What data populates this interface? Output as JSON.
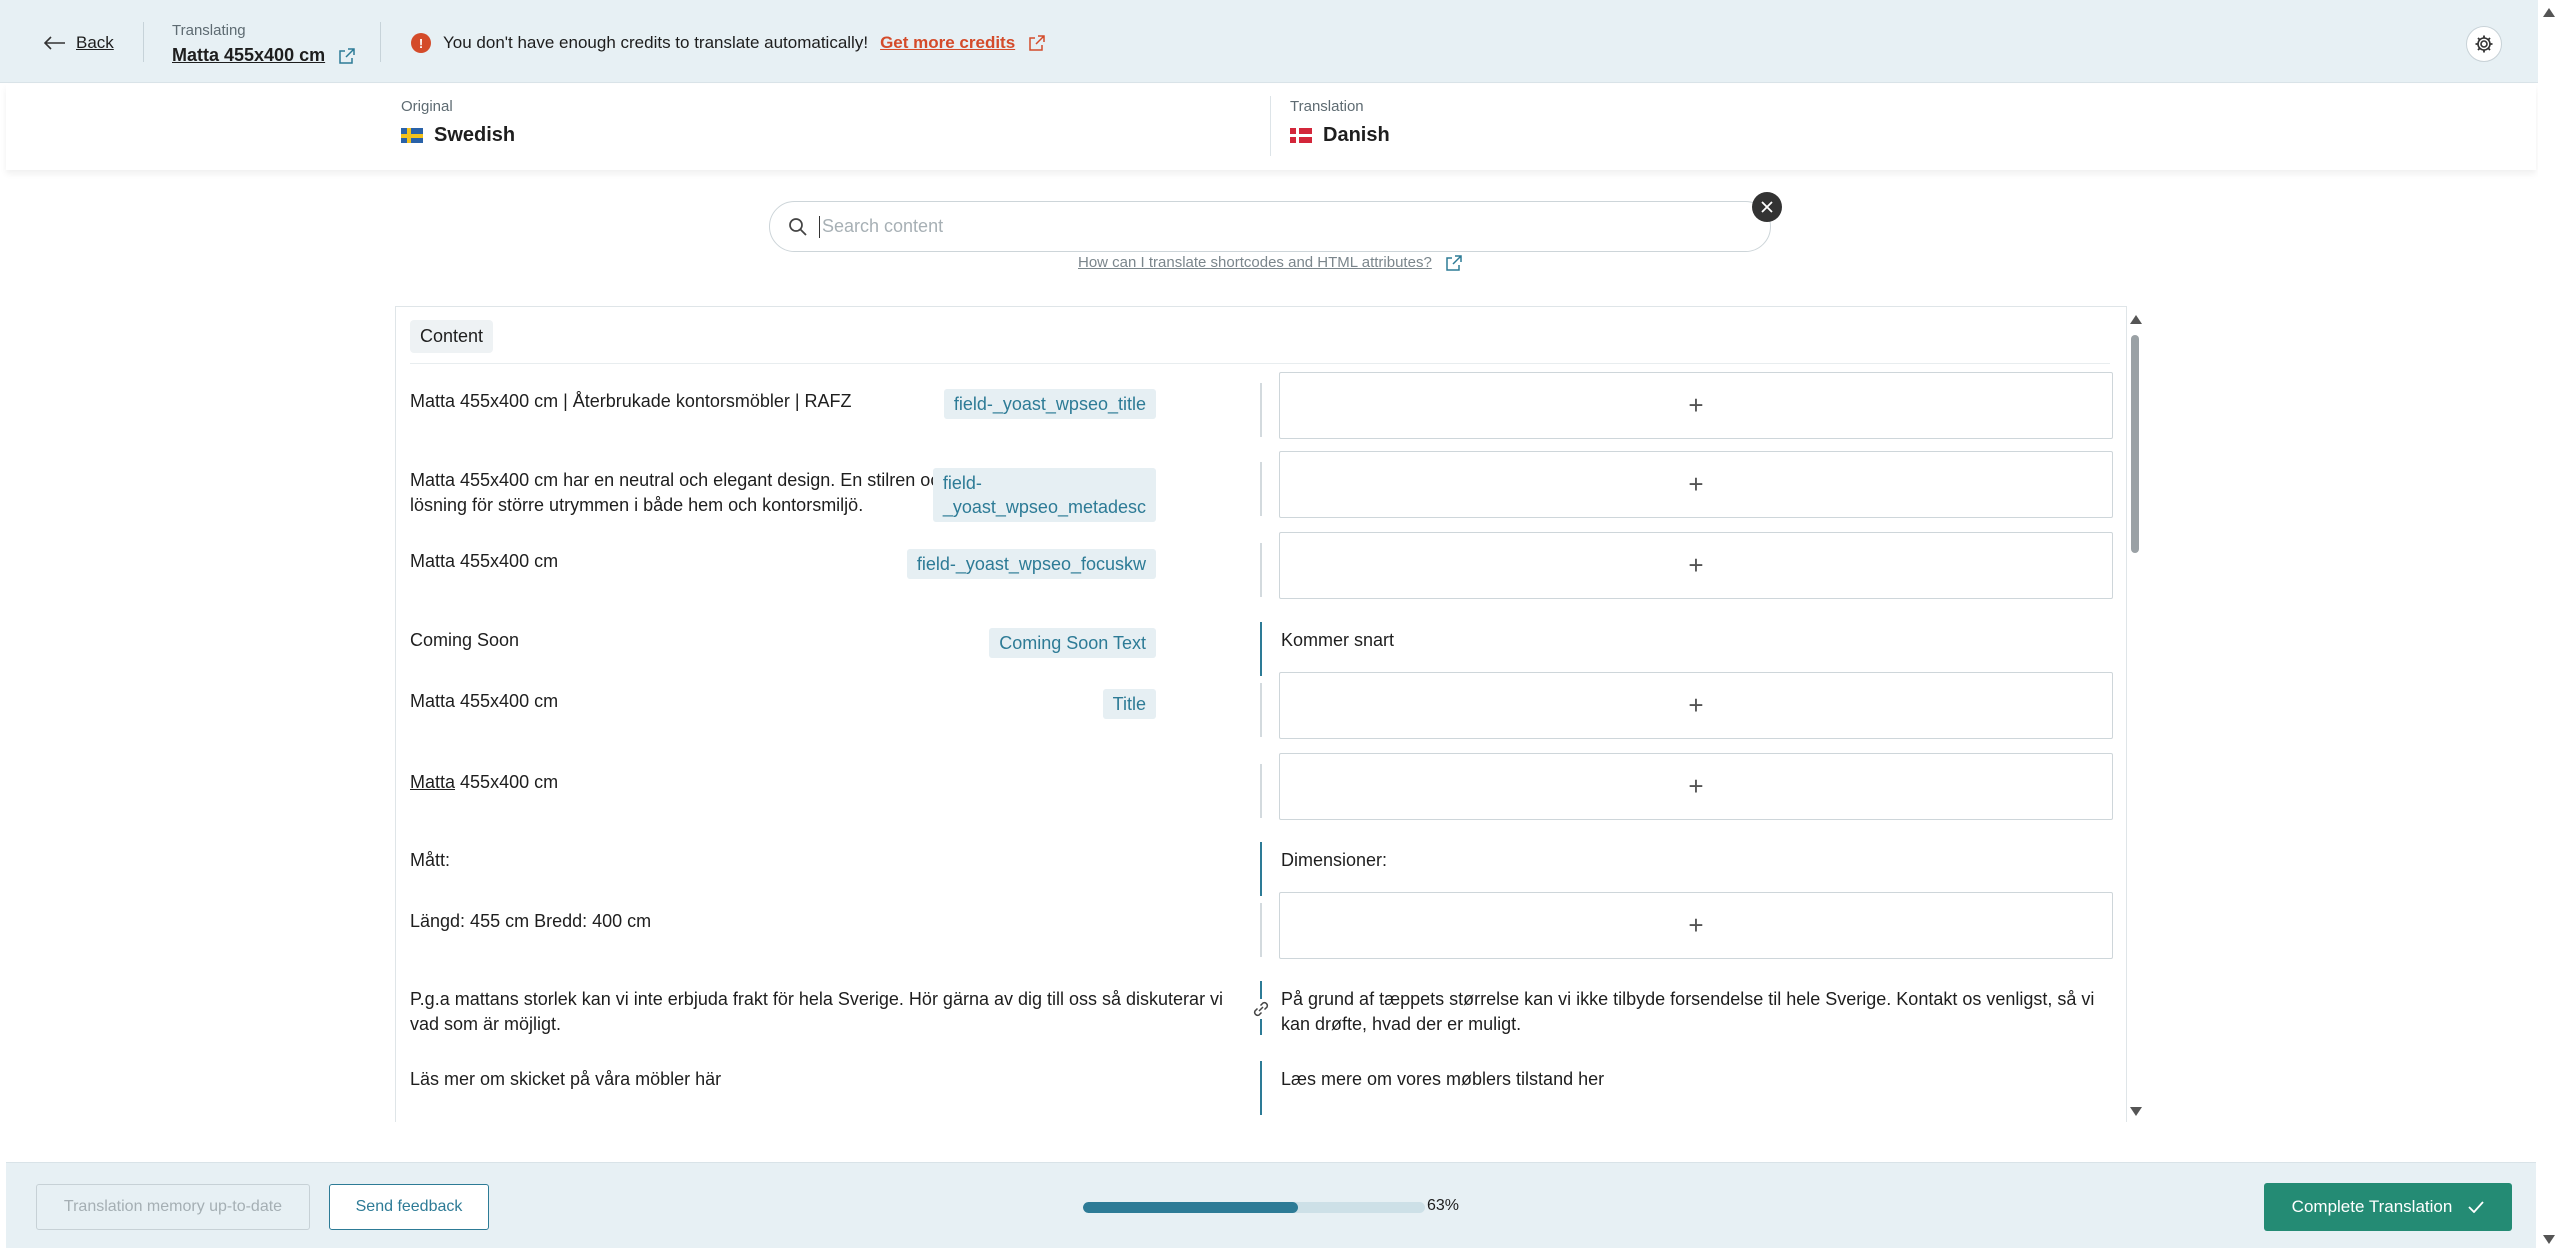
{
  "topbar": {
    "back_label": "Back",
    "translating_label": "Translating",
    "document_title": "Matta 455x400 cm",
    "warning_text": "You don't have enough credits to translate automatically!",
    "credits_link": "Get more credits"
  },
  "languages": {
    "original_label": "Original",
    "original_value": "Swedish",
    "translation_label": "Translation",
    "translation_value": "Danish"
  },
  "search": {
    "placeholder": "Search content",
    "value": "",
    "help_link": "How can I translate shortcodes and HTML attributes?"
  },
  "section_tag": "Content",
  "rows": [
    {
      "source": "Matta 455x400 cm | Återbrukade kontorsmöbler | RAFZ",
      "field": "field-_yoast_wpseo_title",
      "translation": ""
    },
    {
      "source": "Matta 455x400 cm har en neutral och elegant design. En stilren och praktisk lösning för större utrymmen i både hem och kontorsmiljö.",
      "field": "field-\n_yoast_wpseo_metadesc",
      "translation": ""
    },
    {
      "source": "Matta 455x400 cm",
      "field": "field-_yoast_wpseo_focuskw",
      "translation": ""
    },
    {
      "source": "Coming Soon",
      "field": "Coming Soon Text",
      "translation": "Kommer snart"
    },
    {
      "source": "Matta 455x400 cm",
      "field": "Title",
      "translation": ""
    },
    {
      "source_underlined": "Matta",
      "source_rest": " 455x400 cm",
      "translation": ""
    },
    {
      "source": "Mått:",
      "translation": "Dimensioner:"
    },
    {
      "source": "Längd: 455 cm Bredd: 400 cm",
      "translation": ""
    },
    {
      "source": "P.g.a mattans storlek kan vi inte erbjuda frakt för hela Sverige. Hör gärna av dig till oss så diskuterar vi vad som är möjligt.",
      "translation": "På grund af tæppets størrelse kan vi ikke tilbyde forsendelse til hele Sverige. Kontakt os venligst, så vi kan drøfte, hvad der er muligt."
    },
    {
      "source": "Läs mer om skicket på våra möbler här",
      "translation": "Læs mere om vores møblers tilstand her"
    }
  ],
  "footer": {
    "tm_label": "Translation memory up-to-date",
    "feedback_label": "Send feedback",
    "progress": 0.63,
    "progress_text": "63%",
    "complete_label": "Complete Translation"
  },
  "colors": {
    "accent": "#2d7b96",
    "warning": "#d44b2a",
    "complete": "#248b74",
    "topbar_bg": "#e7f0f4"
  },
  "icons": [
    "arrow-left-icon",
    "external-link-icon",
    "alert-icon",
    "gear-icon",
    "search-icon",
    "close-icon",
    "plus-icon",
    "link-icon",
    "check-icon"
  ]
}
